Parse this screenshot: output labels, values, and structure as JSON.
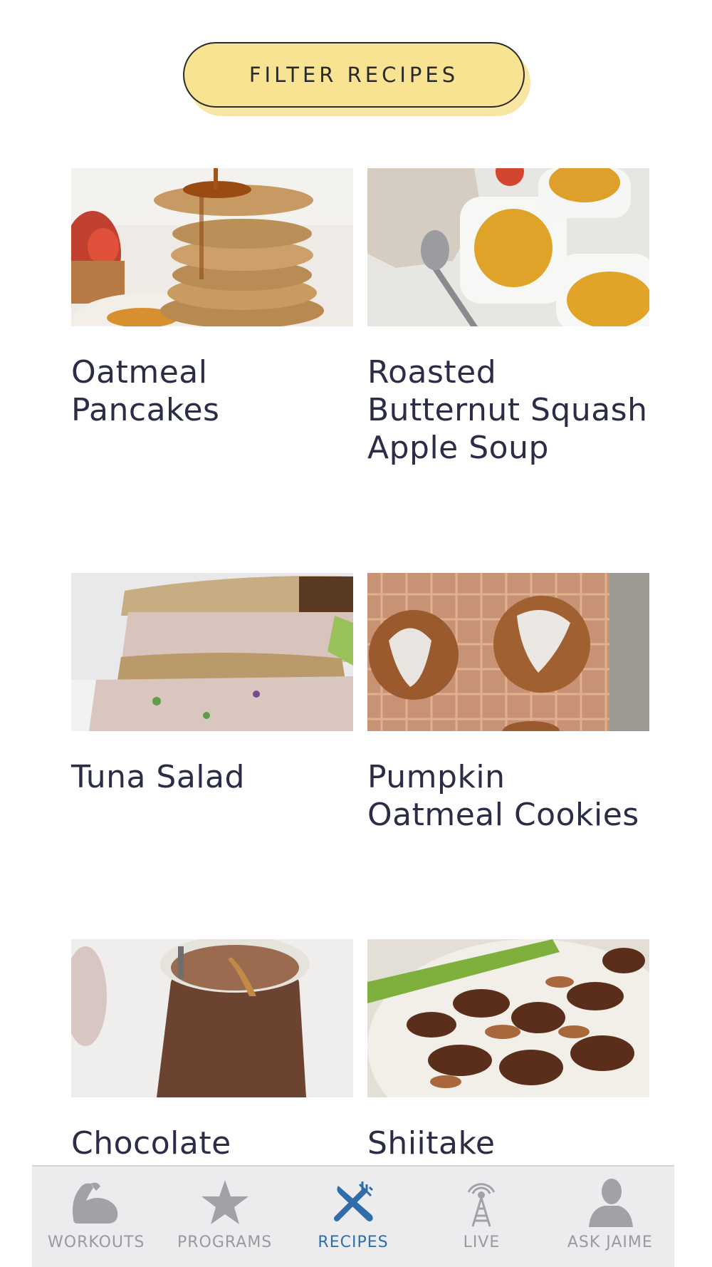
{
  "filter": {
    "label": "FILTER RECIPES"
  },
  "recipes": [
    {
      "title": "Oatmeal Pancakes"
    },
    {
      "title": "Roasted Butternut Squash Apple Soup"
    },
    {
      "title": "Tuna Salad"
    },
    {
      "title": "Pumpkin Oatmeal Cookies"
    },
    {
      "title": "Chocolate"
    },
    {
      "title": "Shiitake"
    }
  ],
  "tabbar": {
    "active": "recipes",
    "tabs": [
      {
        "label": "WORKOUTS",
        "icon": "flexed-bicep-icon"
      },
      {
        "label": "PROGRAMS",
        "icon": "star-icon"
      },
      {
        "label": "RECIPES",
        "icon": "fork-knife-icon"
      },
      {
        "label": "LIVE",
        "icon": "broadcast-tower-icon"
      },
      {
        "label": "ASK JAIME",
        "icon": "person-icon"
      }
    ]
  },
  "colors": {
    "accent": "#2f6eaa",
    "filter_bg": "#f8e393",
    "inactive": "#9a9a9e"
  }
}
